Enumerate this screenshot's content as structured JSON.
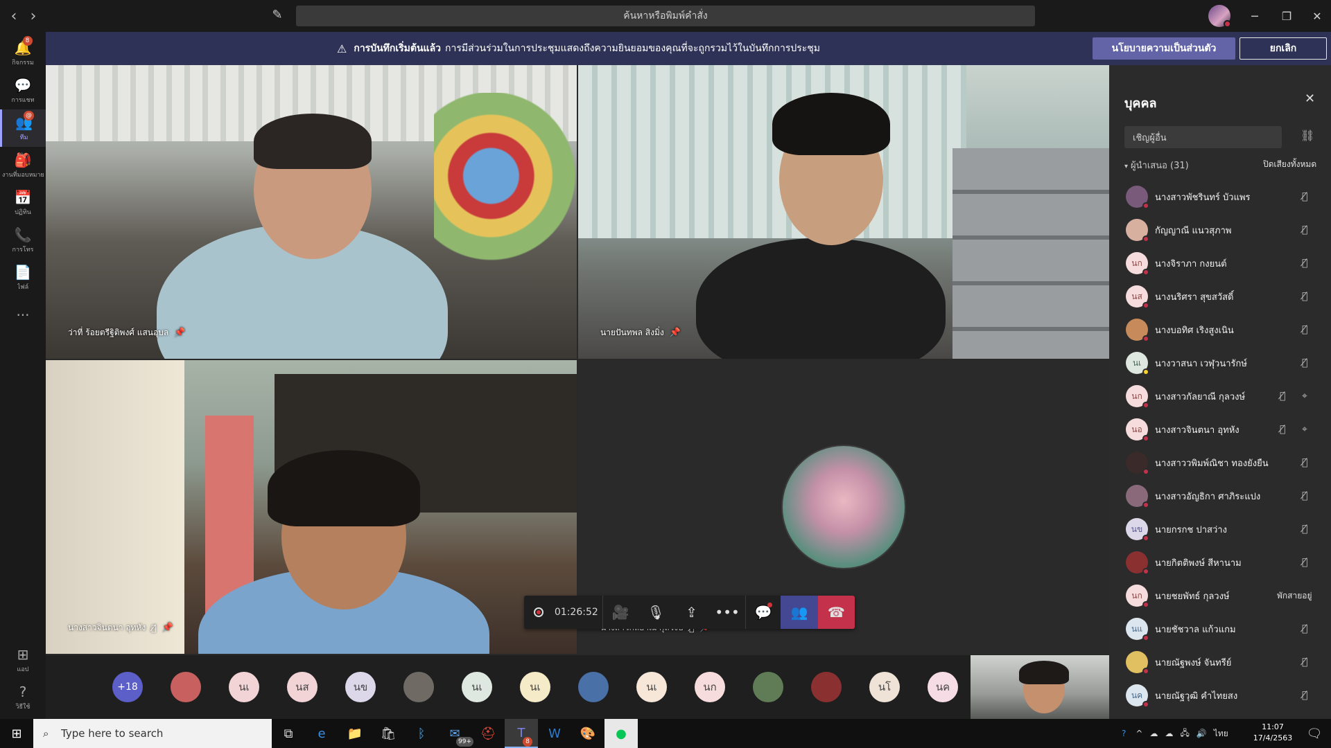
{
  "titlebar": {
    "search_placeholder": "ค้นหาหรือพิมพ์คำสั่ง",
    "minimize": "─",
    "restore": "❐",
    "close": "✕"
  },
  "rail": [
    {
      "label": "กิจกรรม",
      "icon": "bell-icon",
      "glyph": "🔔",
      "badge": "8"
    },
    {
      "label": "การแชท",
      "icon": "chat-icon",
      "glyph": "💬",
      "badge": ""
    },
    {
      "label": "ทีม",
      "icon": "teams-icon",
      "glyph": "👥",
      "badge": "@"
    },
    {
      "label": "งานที่มอบหมาย",
      "icon": "assignments-icon",
      "glyph": "🎒",
      "badge": ""
    },
    {
      "label": "ปฏิทิน",
      "icon": "calendar-icon",
      "glyph": "📅",
      "badge": ""
    },
    {
      "label": "การโทร",
      "icon": "phone-icon",
      "glyph": "📞",
      "badge": ""
    },
    {
      "label": "ไฟล์",
      "icon": "file-icon",
      "glyph": "📄",
      "badge": ""
    },
    {
      "label": "",
      "icon": "more-icon",
      "glyph": "···",
      "badge": ""
    }
  ],
  "rail_bottom": [
    {
      "label": "แอป",
      "icon": "apps-icon",
      "glyph": "⊞"
    },
    {
      "label": "วิธีใช้",
      "icon": "help-icon",
      "glyph": "?"
    }
  ],
  "banner": {
    "bold": "การบันทึกเริ่มต้นแล้ว",
    "text": "การมีส่วนร่วมในการประชุมแสดงถึงความยินยอมของคุณที่จะถูกรวมไว้ในบันทึกการประชุม",
    "policy_button": "นโยบายความเป็นส่วนตัว",
    "cancel_button": "ยกเลิก"
  },
  "tiles": [
    {
      "name": "ว่าที่ ร้อยตรีฐิติพงศ์ แสนอุบล"
    },
    {
      "name": "นายปันทพล สิงมิ่ง"
    },
    {
      "name": "นางสาวจินตนา อุทหัง"
    },
    {
      "name": "นางสาวกัลยาณี กุลวงษ์"
    }
  ],
  "controls": {
    "timer": "01:26:52"
  },
  "gallery": {
    "more": "+18",
    "avatars": [
      "",
      "นเ",
      "นส",
      "นข",
      "",
      "นเ",
      "นเ",
      "",
      "นเ",
      "นก",
      "",
      "",
      "นโ",
      "นค"
    ]
  },
  "panel": {
    "title": "บุคคล",
    "invite_placeholder": "เชิญผู้อื่น",
    "section": "ผู้นำเสนอ (31)",
    "mute_all": "ปิดเสียงทั้งหมด",
    "participants": [
      {
        "name": "นางสาวพัชรินทร์ บัวแพร",
        "initials": "",
        "mic": "muted",
        "status_text": ""
      },
      {
        "name": "กัญญาณี แนวสุภาพ",
        "initials": "",
        "mic": "muted",
        "status_text": ""
      },
      {
        "name": "นางจิราภา กงยนต์",
        "initials": "นก",
        "mic": "muted",
        "status_text": ""
      },
      {
        "name": "นางนริศรา สุขสวัสดิ์",
        "initials": "นส",
        "mic": "muted",
        "status_text": ""
      },
      {
        "name": "นางบอทิศ เริงสูงเนิน",
        "initials": "",
        "mic": "muted",
        "status_text": ""
      },
      {
        "name": "นางวาสนา เวฬุวนารักษ์",
        "initials": "นเ",
        "mic": "muted",
        "status_text": ""
      },
      {
        "name": "นางสาวกัลยาณี กุลวงษ์",
        "initials": "นก",
        "mic": "muted-pinned",
        "status_text": ""
      },
      {
        "name": "นางสาวจินตนา อุทหัง",
        "initials": "นอ",
        "mic": "muted-pinned",
        "status_text": ""
      },
      {
        "name": "นางสาววพิมพ์ณิชา ทองยังยืน",
        "initials": "",
        "mic": "muted",
        "status_text": ""
      },
      {
        "name": "นางสาวอัญธิกา ศาภิระแปง",
        "initials": "",
        "mic": "muted",
        "status_text": ""
      },
      {
        "name": "นายกรกช ปาสว่าง",
        "initials": "นข",
        "mic": "muted",
        "status_text": ""
      },
      {
        "name": "นายกิตติพงษ์ สีหานาม",
        "initials": "",
        "mic": "muted",
        "status_text": ""
      },
      {
        "name": "นายชยพัทธ์ กุลวงษ์",
        "initials": "นก",
        "mic": "",
        "status_text": "พักสายอยู่"
      },
      {
        "name": "นายชัชวาล แก้วแกม",
        "initials": "นแ",
        "mic": "muted",
        "status_text": ""
      },
      {
        "name": "นายณัฐพงษ์ จันทรีย์",
        "initials": "",
        "mic": "muted",
        "status_text": ""
      },
      {
        "name": "นายณัฐวุฒิ คำไทยสง",
        "initials": "นค",
        "mic": "muted",
        "status_text": ""
      }
    ]
  },
  "taskbar": {
    "search_placeholder": "Type here to search",
    "mail_badge": "99+",
    "teams_badge": "8",
    "lang": "ไทย",
    "time": "11:07",
    "date": "17/4/2563"
  },
  "colors": {
    "accent": "#6264a7",
    "banner": "#2f3257",
    "hangup": "#c4314b",
    "busy": "#c4314b"
  }
}
